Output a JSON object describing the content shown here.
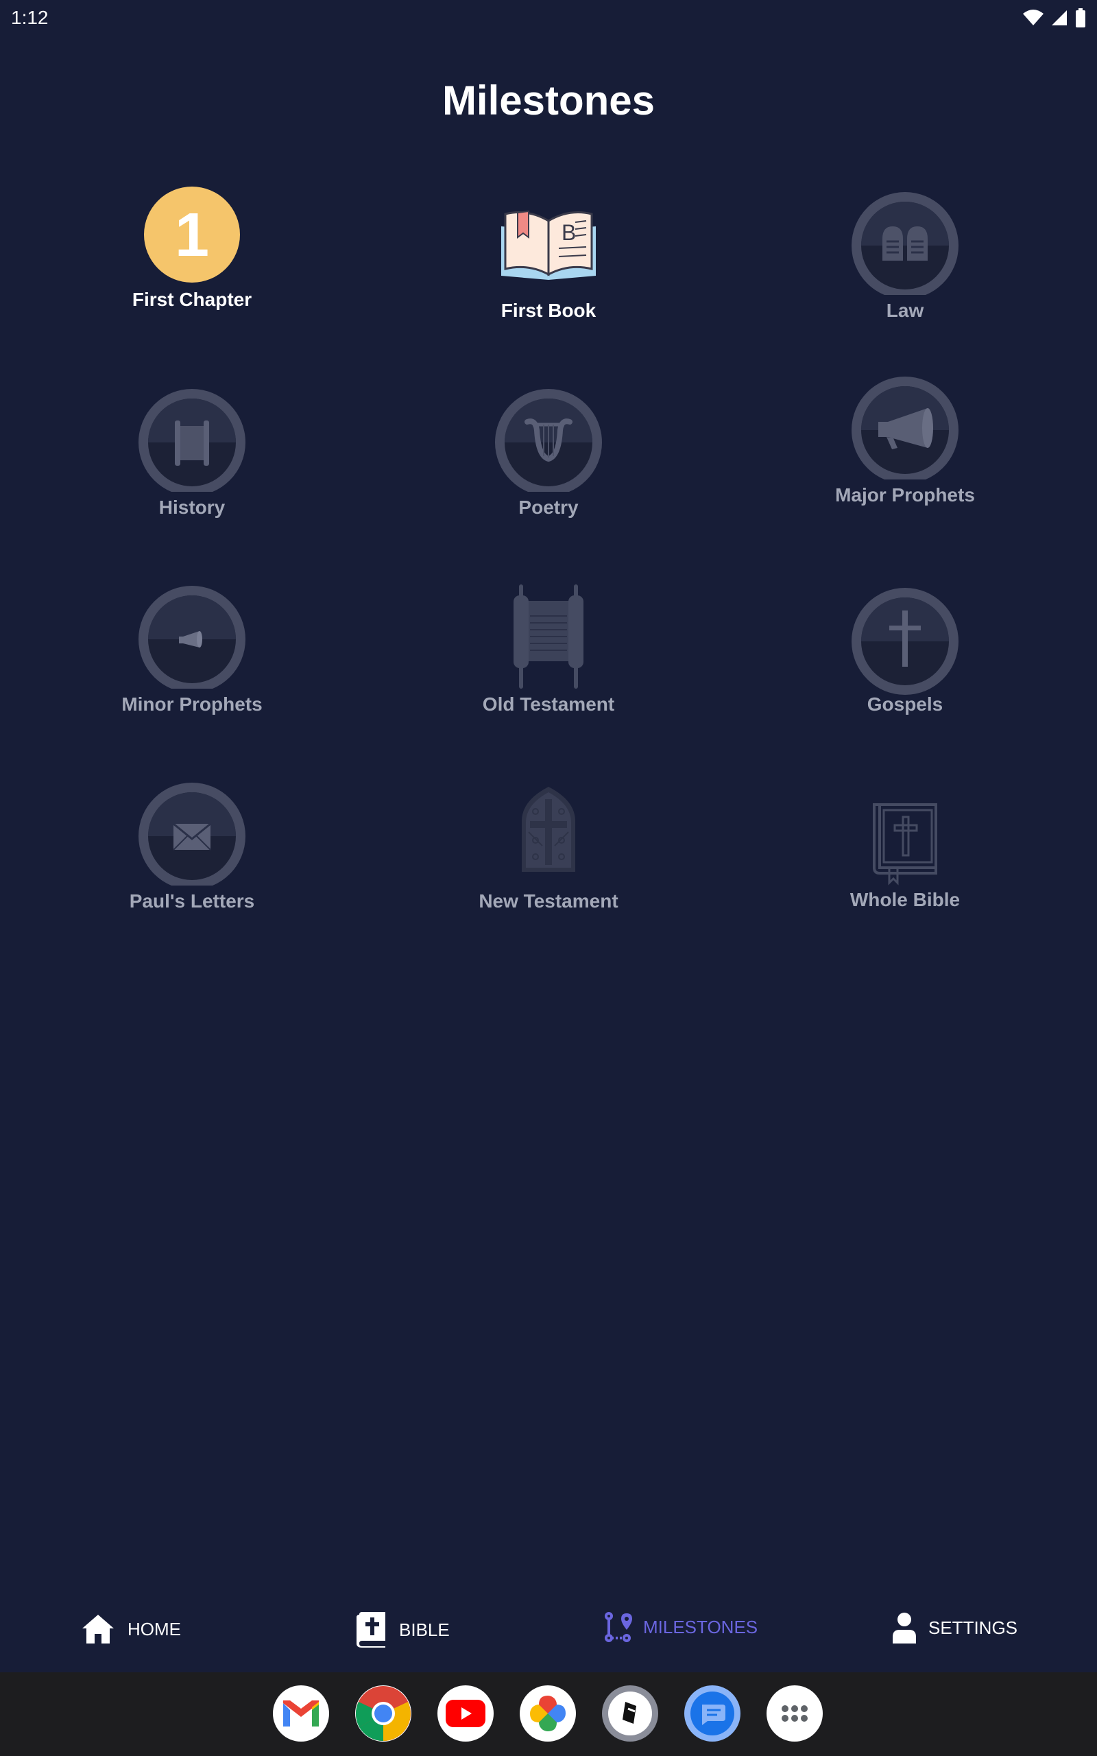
{
  "status": {
    "time": "1:12"
  },
  "page": {
    "title": "Milestones"
  },
  "milestones": [
    {
      "label": "First Chapter",
      "state": "achieved",
      "icon": "number-one-badge-icon",
      "badge_text": "1"
    },
    {
      "label": "First Book",
      "state": "achieved",
      "icon": "open-book-icon"
    },
    {
      "label": "Law",
      "state": "locked",
      "icon": "stone-tablets-icon"
    },
    {
      "label": "History",
      "state": "locked",
      "icon": "scroll-icon"
    },
    {
      "label": "Poetry",
      "state": "locked",
      "icon": "lyre-icon"
    },
    {
      "label": "Major Prophets",
      "state": "locked",
      "icon": "megaphone-icon"
    },
    {
      "label": "Minor Prophets",
      "state": "locked",
      "icon": "small-megaphone-icon"
    },
    {
      "label": "Old Testament",
      "state": "locked",
      "icon": "torah-scroll-icon"
    },
    {
      "label": "Gospels",
      "state": "locked",
      "icon": "cross-icon"
    },
    {
      "label": "Paul's Letters",
      "state": "locked",
      "icon": "envelope-icon"
    },
    {
      "label": "New Testament",
      "state": "locked",
      "icon": "church-window-icon"
    },
    {
      "label": "Whole Bible",
      "state": "locked",
      "icon": "bible-book-icon"
    }
  ],
  "nav": {
    "home": "HOME",
    "bible": "BIBLE",
    "milestones": "MILESTONES",
    "settings": "SETTINGS",
    "active": "milestones"
  },
  "colors": {
    "background": "#171d37",
    "accent": "#6b66e0",
    "badge_gold": "#f5c56b",
    "locked_label": "#a3a8b8"
  },
  "dock": {
    "apps": [
      "gmail-icon",
      "chrome-icon",
      "youtube-icon",
      "photos-icon",
      "bible-app-icon",
      "messages-icon",
      "app-drawer-icon"
    ]
  }
}
